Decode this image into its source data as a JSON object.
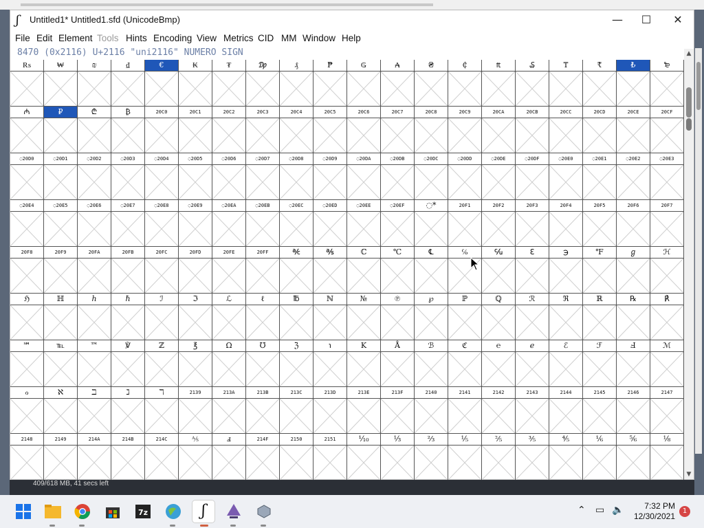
{
  "window": {
    "title": "Untitled1*  Untitled1.sfd (UnicodeBmp)",
    "app_icon": "fontforge-icon",
    "controls": {
      "minimize": "—",
      "maximize": "☐",
      "close": "✕"
    }
  },
  "menu": {
    "items": [
      "File",
      "Edit",
      "Element",
      "Tools",
      "Hints",
      "Encoding",
      "View",
      "Metrics",
      "CID",
      "MM",
      "Window",
      "Help"
    ],
    "disabled": [
      "Tools"
    ]
  },
  "info_line": "8470 (0x2116) U+2116 \"uni2116\" NUMERO SIGN",
  "glyph_rows": [
    [
      "₨",
      "₩",
      "₪",
      "₫",
      "€",
      "₭",
      "₮",
      "₯",
      "₰",
      "₱",
      "₲",
      "₳",
      "₴",
      "₵",
      "₶",
      "₷",
      "₸",
      "₹",
      "₺",
      "₻"
    ],
    [
      "₼",
      "₽",
      "₾",
      "₿",
      "20C0",
      "20C1",
      "20C2",
      "20C3",
      "20C4",
      "20C5",
      "20C6",
      "20C7",
      "20C8",
      "20C9",
      "20CA",
      "20CB",
      "20CC",
      "20CD",
      "20CE",
      "20CF"
    ],
    [
      "◌20D0",
      "◌20D1",
      "◌20D2",
      "◌20D3",
      "◌20D4",
      "◌20D5",
      "◌20D6",
      "◌20D7",
      "◌20D8",
      "◌20D9",
      "◌20DA",
      "◌20DB",
      "◌20DC",
      "◌20DD",
      "◌20DE",
      "◌20DF",
      "◌20E0",
      "◌20E1",
      "◌20E2",
      "◌20E3"
    ],
    [
      "◌20E4",
      "◌20E5",
      "◌20E6",
      "◌20E7",
      "◌20E8",
      "◌20E9",
      "◌20EA",
      "◌20EB",
      "◌20EC",
      "◌20ED",
      "◌20EE",
      "◌20EF",
      "◌*",
      "20F1",
      "20F2",
      "20F3",
      "20F4",
      "20F5",
      "20F6",
      "20F7"
    ],
    [
      "20F8",
      "20F9",
      "20FA",
      "20FB",
      "20FC",
      "20FD",
      "20FE",
      "20FF",
      "℀",
      "℁",
      "ℂ",
      "℃",
      "℄",
      "℅",
      "℆",
      "ℇ",
      "℈",
      "℉",
      "ℊ",
      "ℋ"
    ],
    [
      "ℌ",
      "ℍ",
      "ℎ",
      "ℏ",
      "ℐ",
      "ℑ",
      "ℒ",
      "ℓ",
      "℔",
      "ℕ",
      "№",
      "℗",
      "℘",
      "ℙ",
      "ℚ",
      "ℛ",
      "ℜ",
      "ℝ",
      "℞",
      "℟"
    ],
    [
      "℠",
      "℡",
      "™",
      "℣",
      "ℤ",
      "℥",
      "Ω",
      "℧",
      "ℨ",
      "℩",
      "K",
      "Å",
      "ℬ",
      "ℭ",
      "℮",
      "ℯ",
      "ℰ",
      "ℱ",
      "Ⅎ",
      "ℳ"
    ],
    [
      "ℴ",
      "ℵ",
      "ℶ",
      "ℷ",
      "ℸ",
      "2139",
      "213A",
      "213B",
      "213C",
      "213D",
      "213E",
      "213F",
      "2140",
      "2141",
      "2142",
      "2143",
      "2144",
      "2145",
      "2146",
      "2147"
    ],
    [
      "2148",
      "2149",
      "214A",
      "214B",
      "214C",
      "⅍",
      "ⅎ",
      "214F",
      "2150",
      "2151",
      "⅒",
      "⅓",
      "⅔",
      "⅕",
      "⅖",
      "⅗",
      "⅘",
      "⅙",
      "⅚",
      "⅛"
    ]
  ],
  "selected_cells": [
    [
      0,
      4
    ],
    [
      0,
      18
    ],
    [
      1,
      1
    ]
  ],
  "status": {
    "text": "409/618 MB, 41 secs left"
  },
  "taskbar": {
    "icons": [
      "windows-start-icon",
      "file-explorer-icon",
      "chrome-icon",
      "store-icon",
      "7zip-icon",
      "browser-icon",
      "fontforge-icon",
      "inkscape-icon",
      "other-app-icon"
    ],
    "time": "7:32 PM",
    "date": "12/30/2021",
    "notification_count": "1"
  }
}
